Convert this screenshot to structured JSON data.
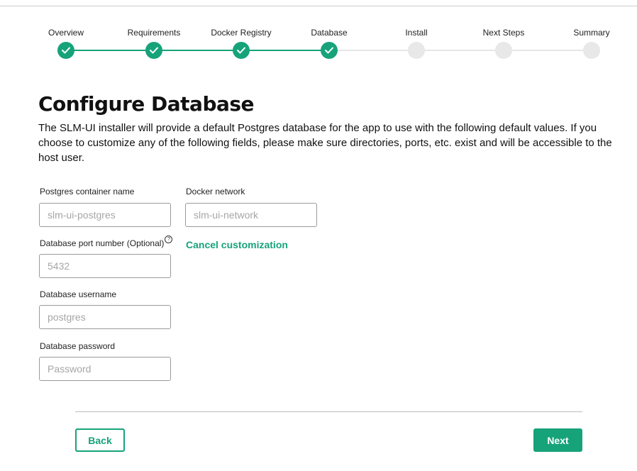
{
  "stepper": {
    "steps": [
      {
        "label": "Overview",
        "status": "complete"
      },
      {
        "label": "Requirements",
        "status": "complete"
      },
      {
        "label": "Docker Registry",
        "status": "complete"
      },
      {
        "label": "Database",
        "status": "complete"
      },
      {
        "label": "Install",
        "status": "pending"
      },
      {
        "label": "Next Steps",
        "status": "pending"
      },
      {
        "label": "Summary",
        "status": "pending"
      }
    ],
    "complete_color": "#17a37a",
    "pending_color": "#e8e8e8"
  },
  "page": {
    "title": "Configure Database",
    "description": "The SLM-UI installer will provide a default Postgres database for the app to use with the following default values. If you choose to customize any of the following fields, please make sure directories, ports, etc. exist and will be accessible to the host user."
  },
  "form": {
    "container_name": {
      "label": "Postgres container name",
      "placeholder": "slm-ui-postgres",
      "value": ""
    },
    "docker_network": {
      "label": "Docker network",
      "placeholder": "slm-ui-network",
      "value": ""
    },
    "port": {
      "label": "Database port number (Optional)",
      "help_icon": "question-circle-icon",
      "help_glyph": "?",
      "placeholder": "5432",
      "value": ""
    },
    "username": {
      "label": "Database username",
      "placeholder": "postgres",
      "value": ""
    },
    "password": {
      "label": "Database password",
      "placeholder": "Password",
      "value": ""
    },
    "cancel_customization": "Cancel customization"
  },
  "footer": {
    "back_label": "Back",
    "next_label": "Next"
  },
  "colors": {
    "accent": "#17a37a"
  }
}
